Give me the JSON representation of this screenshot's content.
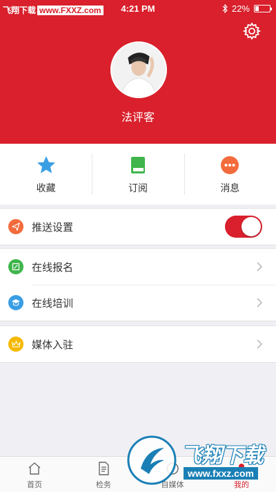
{
  "status_bar": {
    "watermark_text": "飞翔下载",
    "watermark_url": "www.FXXZ.com",
    "time": "4:21 PM",
    "battery": "22%",
    "battery_level": 0.22
  },
  "profile": {
    "username": "法评客",
    "settings_icon": "gear-icon"
  },
  "quick_actions": [
    {
      "label": "收藏",
      "icon": "star-icon",
      "color": "#3a9ee4"
    },
    {
      "label": "订阅",
      "icon": "book-icon",
      "color": "#3fb54b"
    },
    {
      "label": "消息",
      "icon": "message-icon",
      "color": "#f36b3c"
    }
  ],
  "settings": {
    "push": {
      "label": "推送设置",
      "enabled": true
    },
    "items": [
      {
        "label": "在线报名"
      },
      {
        "label": "在线培训"
      },
      {
        "label": "媒体入驻"
      }
    ]
  },
  "tabs": [
    {
      "label": "首页",
      "icon": "home-icon"
    },
    {
      "label": "检务",
      "icon": "document-icon"
    },
    {
      "label": "自媒体",
      "icon": "media-icon"
    },
    {
      "label": "我的",
      "icon": "profile-icon",
      "active": true
    }
  ],
  "watermark": {
    "title": "飞翔下载",
    "url": "www.fxxz.com"
  },
  "colors": {
    "accent": "#d9202c",
    "background": "#efeff4"
  }
}
